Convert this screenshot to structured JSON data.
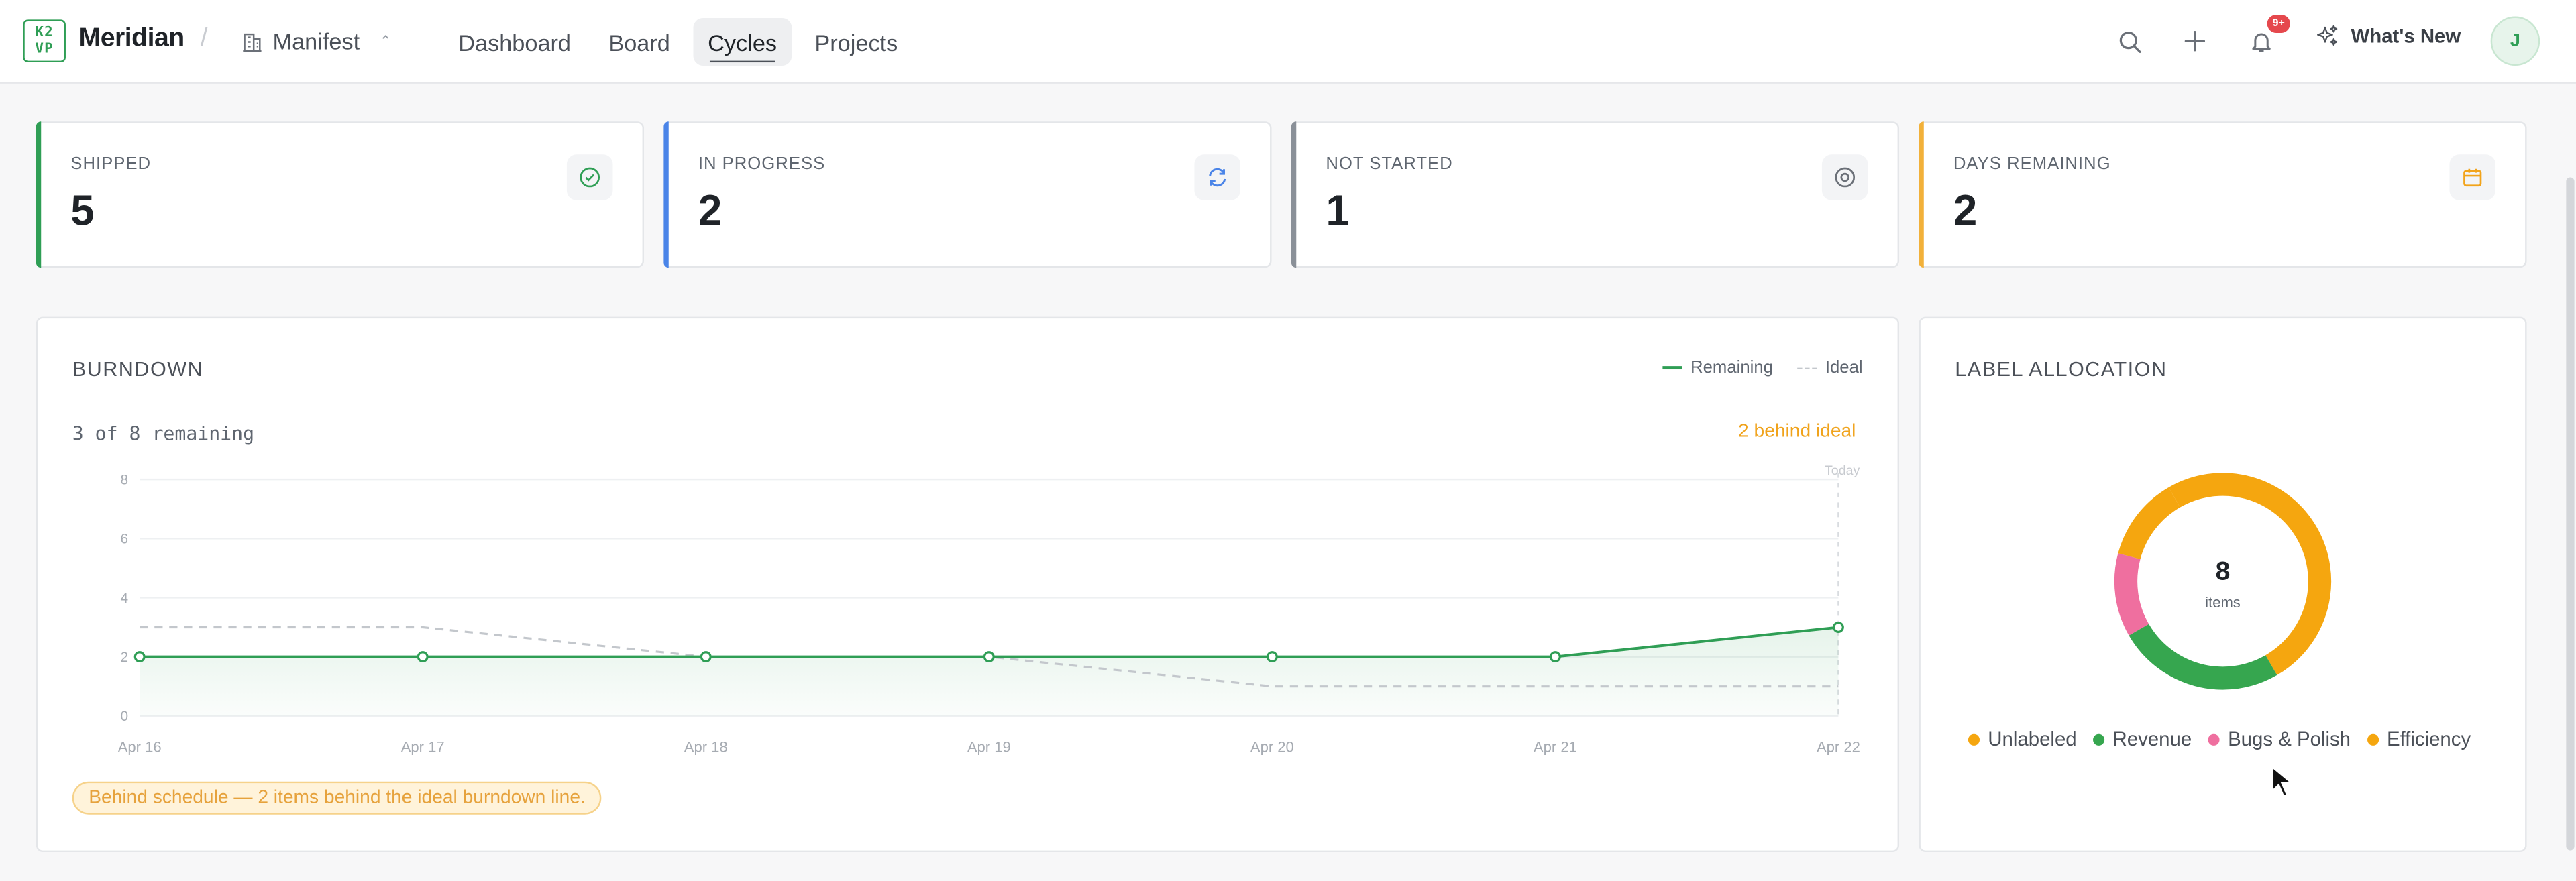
{
  "app": {
    "logo_line1": "K2",
    "logo_line2": "VP",
    "name": "Meridian",
    "workspace": "Manifest"
  },
  "nav": {
    "tabs": [
      {
        "label": "Dashboard",
        "active": false
      },
      {
        "label": "Board",
        "active": false
      },
      {
        "label": "Cycles",
        "active": true
      },
      {
        "label": "Projects",
        "active": false
      }
    ]
  },
  "toolbar": {
    "notification_count": "9+",
    "whats_new": "What's New",
    "avatar_initial": "J"
  },
  "stats": [
    {
      "label": "SHIPPED",
      "value": "5",
      "color": "#2f9e55",
      "icon": "check-circle-icon"
    },
    {
      "label": "IN PROGRESS",
      "value": "2",
      "color": "#4a84e8",
      "icon": "refresh-icon"
    },
    {
      "label": "NOT STARTED",
      "value": "1",
      "color": "#8a9098",
      "icon": "target-circle-icon"
    },
    {
      "label": "DAYS REMAINING",
      "value": "2",
      "color": "#f2b13a",
      "icon": "calendar-icon"
    }
  ],
  "burndown": {
    "title": "BURNDOWN",
    "legend_remaining": "Remaining",
    "legend_ideal": "Ideal",
    "summary": "3 of 8 remaining",
    "status": "2 behind ideal",
    "today_label": "Today",
    "notice": "Behind schedule — 2 items behind the ideal burndown line."
  },
  "allocation": {
    "title": "LABEL ALLOCATION",
    "total": "8",
    "total_label": "items"
  },
  "chart_data": [
    {
      "type": "line",
      "x": [
        "Apr 16",
        "Apr 17",
        "Apr 18",
        "Apr 19",
        "Apr 20",
        "Apr 21",
        "Apr 22"
      ],
      "series": [
        {
          "name": "Remaining",
          "values": [
            2,
            2,
            2,
            2,
            2,
            2,
            3
          ],
          "color": "#2f9e55"
        },
        {
          "name": "Ideal",
          "values": [
            3,
            3,
            2,
            2,
            1,
            1,
            1
          ],
          "color": "#c3c7cc"
        }
      ],
      "yticks": [
        0,
        2,
        4,
        6,
        8
      ],
      "ylim": [
        0,
        8
      ],
      "grid": true
    },
    {
      "type": "pie",
      "categories": [
        "Unlabeled",
        "Revenue",
        "Bugs & Polish",
        "Efficiency"
      ],
      "values": [
        4,
        2,
        1,
        1
      ],
      "colors": [
        "#f5a60f",
        "#36a64f",
        "#ef6f9f",
        "#f5a60f"
      ]
    }
  ]
}
